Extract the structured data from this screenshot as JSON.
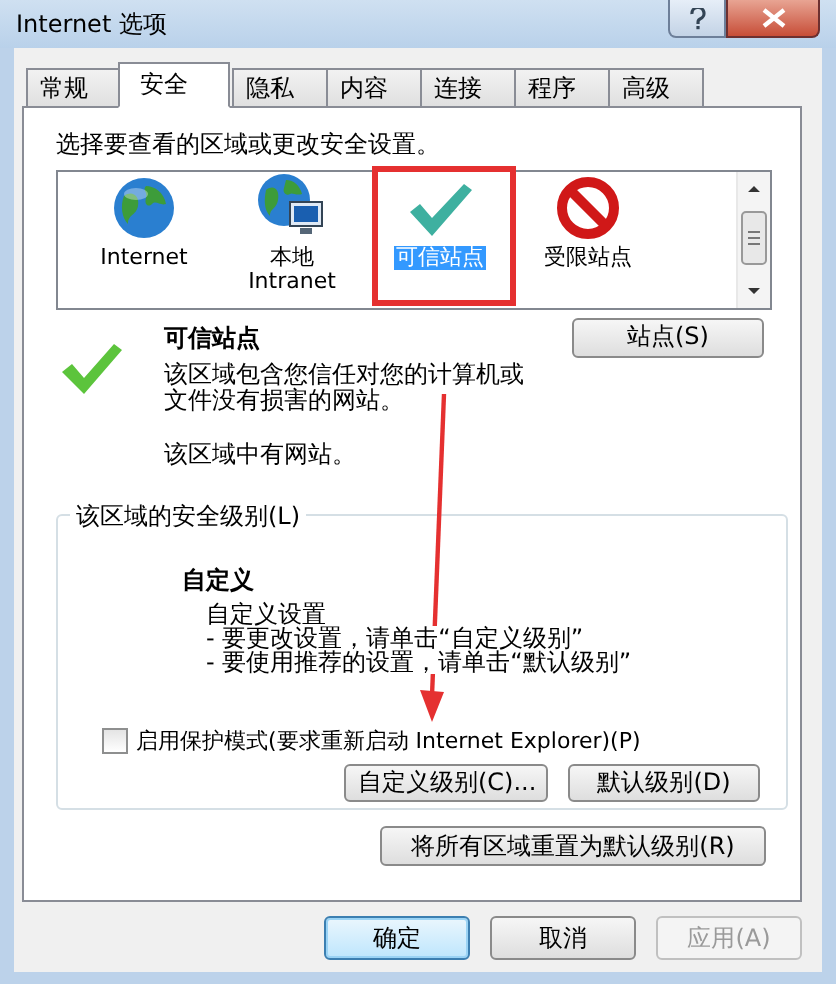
{
  "window": {
    "title": "Internet 选项"
  },
  "tabs": [
    {
      "label": "常规",
      "selected": false
    },
    {
      "label": "安全",
      "selected": true
    },
    {
      "label": "隐私",
      "selected": false
    },
    {
      "label": "内容",
      "selected": false
    },
    {
      "label": "连接",
      "selected": false
    },
    {
      "label": "程序",
      "selected": false
    },
    {
      "label": "高级",
      "selected": false
    }
  ],
  "zones": {
    "prompt": "选择要查看的区域或更改安全设置。",
    "items": [
      {
        "label": "Internet",
        "kind": "globe",
        "selected": false
      },
      {
        "label": "本地\nIntranet",
        "kind": "globe-monitor",
        "selected": false
      },
      {
        "label": "可信站点",
        "kind": "check",
        "selected": true
      },
      {
        "label": "受限站点",
        "kind": "prohibition",
        "selected": false
      }
    ]
  },
  "zone_detail": {
    "title": "可信站点",
    "description": [
      "该区域包含您信任对您的计算机或",
      "文件没有损害的网站。"
    ],
    "note": "该区域中有网站。",
    "sites_button": "站点(S)"
  },
  "security_level": {
    "legend": "该区域的安全级别(L)",
    "level_name": "自定义",
    "lines": [
      "自定义设置",
      "- 要更改设置，请单击“自定义级别”",
      "- 要使用推荐的设置，请单击“默认级别”"
    ],
    "protected_mode": {
      "label": "启用保护模式(要求重新启动 Internet Explorer)(P)",
      "checked": false
    },
    "buttons": [
      {
        "label": "自定义级别(C)...",
        "disabled": false
      },
      {
        "label": "默认级别(D)",
        "disabled": false
      }
    ]
  },
  "reset_button": "将所有区域重置为默认级别(R)",
  "dialog_buttons": [
    {
      "label": "确定",
      "default": true,
      "disabled": false
    },
    {
      "label": "取消",
      "default": false,
      "disabled": false
    },
    {
      "label": "应用(A)",
      "default": false,
      "disabled": true
    }
  ],
  "annotations": {
    "highlight_selected_zone": true,
    "arrow_to_custom_level": true
  }
}
